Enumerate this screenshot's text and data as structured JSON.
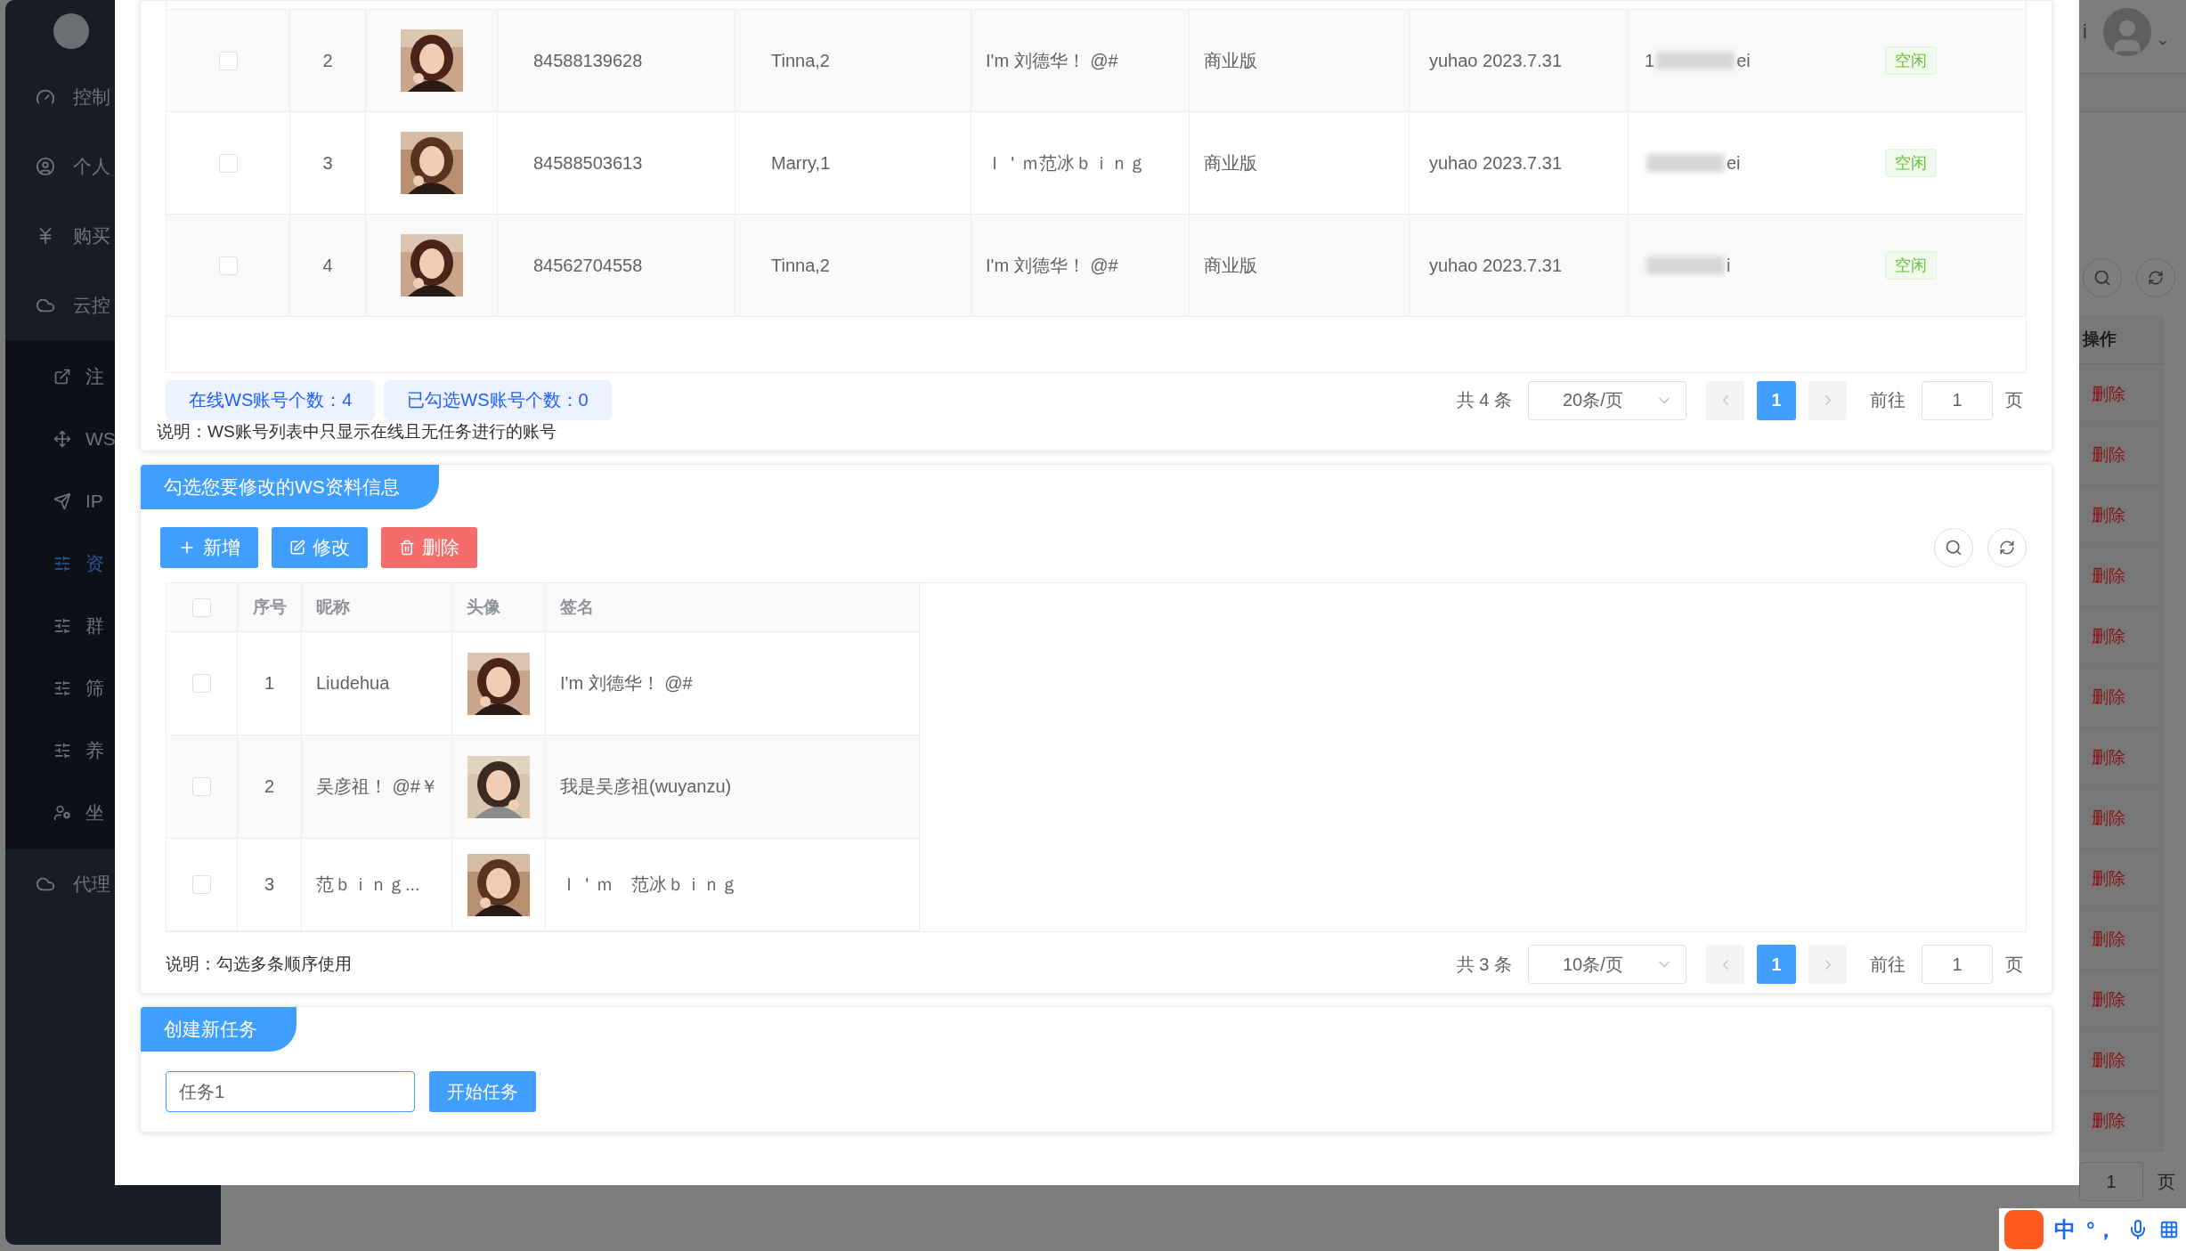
{
  "sidebar": {
    "items": [
      {
        "label": "控制",
        "selected": false
      },
      {
        "label": "个人",
        "selected": false
      },
      {
        "label": "购买",
        "selected": false
      },
      {
        "label": "云控",
        "selected": false,
        "expanded": true,
        "children": [
          {
            "label": "注",
            "selected": false
          },
          {
            "label": "WS",
            "selected": false
          },
          {
            "label": "IP",
            "selected": false
          },
          {
            "label": "资",
            "selected": true
          },
          {
            "label": "群",
            "selected": false
          },
          {
            "label": "筛",
            "selected": false
          },
          {
            "label": "养",
            "selected": false
          },
          {
            "label": "坐",
            "selected": false
          }
        ]
      },
      {
        "label": "代理",
        "selected": false
      }
    ]
  },
  "background_page": {
    "user_name": "i",
    "actions_header": "操作",
    "row_actions": [
      "删除",
      "删除",
      "删除",
      "删除",
      "删除",
      "删除",
      "删除",
      "删除",
      "删除",
      "删除",
      "删除",
      "删除",
      "删除"
    ],
    "pager": {
      "goto_value": "1",
      "page_unit": "页"
    }
  },
  "dialog": {
    "accounts": {
      "rows": [
        {
          "checked": false,
          "index": "2",
          "phone": "84588139628",
          "name": "Tinna,2",
          "signature": "I'm 刘德华！ @#",
          "edition": "商业版",
          "remark": "yuhao 2023.7.31",
          "account_start": "1",
          "account_end": "ei",
          "status": "空闲"
        },
        {
          "checked": false,
          "index": "3",
          "phone": "84588503613",
          "name": "Marry,1",
          "signature": "Ｉ＇ｍ范冰ｂｉｎｇ",
          "edition": "商业版",
          "remark": "yuhao 2023.7.31",
          "account_end": "ei",
          "status": "空闲"
        },
        {
          "checked": false,
          "index": "4",
          "phone": "84562704558",
          "name": "Tinna,2",
          "signature": "I'm 刘德华！ @#",
          "edition": "商业版",
          "remark": "yuhao 2023.7.31",
          "account_end": "i",
          "status": "空闲"
        }
      ],
      "online_count": "在线WS账号个数：4",
      "selected_count": "已勾选WS账号个数：0",
      "note": "说明：WS账号列表中只显示在线且无任务进行的账号",
      "pagination": {
        "total": "共 4 条",
        "page_size": "20条/页",
        "pages": [
          {
            "label": "1",
            "selected": true
          }
        ],
        "goto_label": "前往",
        "goto_value": "1",
        "page_unit": "页"
      }
    },
    "profiles": {
      "title": "勾选您要修改的WS资料信息",
      "buttons": [
        {
          "label": "新增",
          "kind": "add"
        },
        {
          "label": "修改",
          "kind": "edit"
        },
        {
          "label": "删除",
          "kind": "delete"
        }
      ],
      "columns": [
        "序号",
        "昵称",
        "头像",
        "签名"
      ],
      "header_checked": false,
      "rows": [
        {
          "checked": false,
          "index": "1",
          "nickname": "Liudehua",
          "signature": "I'm 刘德华！ @#"
        },
        {
          "checked": false,
          "index": "2",
          "nickname": "吴彦祖！ @#￥",
          "signature": "我是吴彦祖(wuyanzu)"
        },
        {
          "checked": false,
          "index": "3",
          "nickname": "范ｂｉｎｇ...",
          "signature": "Ｉ＇ｍ　范冰ｂｉｎｇ"
        }
      ],
      "note": "说明：勾选多条顺序使用",
      "pagination": {
        "total": "共 3 条",
        "page_size": "10条/页",
        "pages": [
          {
            "label": "1",
            "selected": true
          }
        ],
        "goto_label": "前往",
        "goto_value": "1",
        "page_unit": "页"
      }
    },
    "task": {
      "title": "创建新任务",
      "input_value": "任务1",
      "start_button": "开始任务"
    }
  },
  "ime_toolbar": {
    "mode": "中",
    "punctuation": "°，"
  }
}
